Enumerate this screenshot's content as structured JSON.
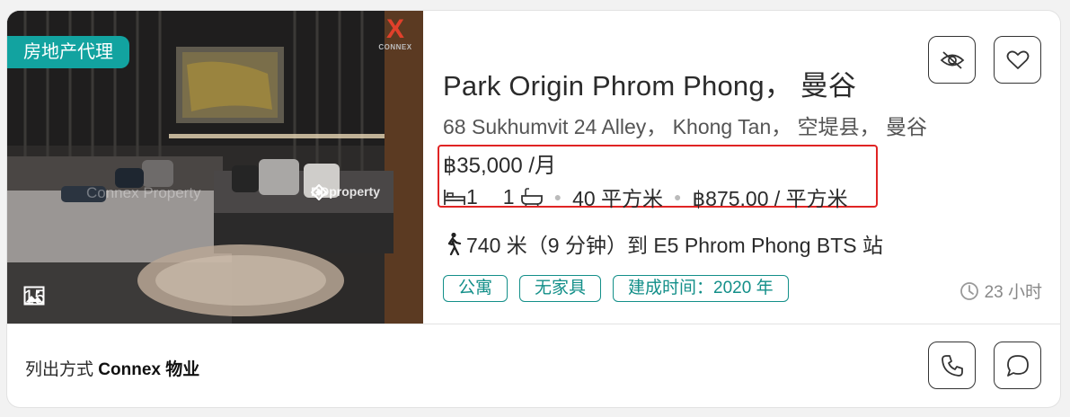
{
  "photo": {
    "badge": "房地产代理",
    "count": "15",
    "watermark_left": "Connex Property",
    "watermark_right": "DDproperty",
    "logo_letter": "X",
    "logo_text": "CONNEX"
  },
  "listing": {
    "title": "Park Origin Phrom Phong， 曼谷",
    "address": "68 Sukhumvit 24 Alley， Khong Tan， 空堤县， 曼谷",
    "price": "฿35,000 /月",
    "bedrooms": "1",
    "bathrooms": "1",
    "area": "40 平方米",
    "price_per_sqm": "฿875.00 / 平方米",
    "transit": "740 米（9 分钟）到 E5 Phrom Phong BTS 站",
    "tags": [
      "公寓",
      "无家具",
      "建成时间：2020 年"
    ],
    "posted": "23 小时"
  },
  "footer": {
    "prefix": "列出方式",
    "agent": "Connex 物业"
  },
  "icons": {
    "hide": "eye-slash-icon",
    "favorite": "heart-icon",
    "call": "phone-icon",
    "chat": "chat-bubble-icon"
  },
  "colors": {
    "accent": "#12a3a0",
    "tag": "#138f89",
    "highlight_border": "#e02424"
  }
}
